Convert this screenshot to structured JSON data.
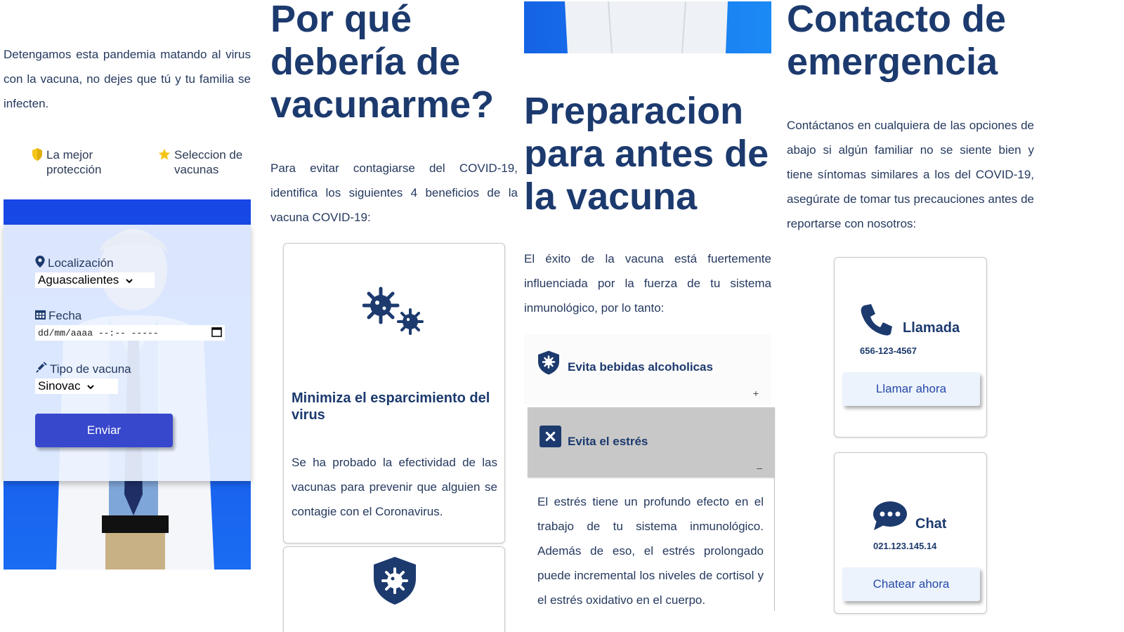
{
  "intro": {
    "text": "Detengamos esta pandemia matando al virus con la vacuna, no dejes que tú y tu familia se infecten."
  },
  "badges": [
    {
      "icon": "shield-icon",
      "label": "La mejor protección",
      "color": "#f5c518"
    },
    {
      "icon": "star-icon",
      "label": "Seleccion de vacunas",
      "color": "#f5c518"
    }
  ],
  "form": {
    "location": {
      "icon": "map-pin-icon",
      "label": "Localización",
      "value": "Aguascalientes"
    },
    "date": {
      "icon": "calendar-icon",
      "label": "Fecha",
      "value": "dd/mm/aaaa  --:--  -----"
    },
    "vaccine": {
      "icon": "syringe-icon",
      "label": "Tipo de vacuna",
      "value": "Sinovac"
    },
    "submit_label": "Enviar"
  },
  "why": {
    "title": "Por qué debería de vacunarme?",
    "text": "Para evitar contagiarse del COVID-19, identifica los siguientes 4 beneficios de la vacuna COVID-19:",
    "cards": [
      {
        "icon": "virus-icon",
        "title": "Minimiza el esparcimiento del virus",
        "text": "Se ha probado la efectividad de las vacunas para prevenir que alguien se contagie con el Coronavirus."
      },
      {
        "icon": "shield-virus-icon"
      }
    ]
  },
  "prep": {
    "title": "Preparacion para antes de la vacuna",
    "text": "El éxito de la vacuna está fuertemente influenciada por la fuerza de tu sistema inmunológico, por lo tanto:",
    "items": [
      {
        "icon": "shield-virus-icon",
        "title": "Evita bebidas alcoholicas",
        "toggle": "+"
      },
      {
        "icon": "close-box-icon",
        "title": "Evita el estrés",
        "toggle": "–",
        "body": "El estrés tiene un profundo efecto en el trabajo de tu sistema inmunológico. Además de eso, el estrés prolongado puede incremental los niveles de cortisol y el estrés oxidativo en el cuerpo."
      }
    ]
  },
  "contact": {
    "title": "Contacto de emergencia",
    "text": "Contáctanos en cualquiera de las opciones de abajo si algún familiar no se siente bien y tiene síntomas similares a los del COVID-19, asegúrate de tomar tus precauciones antes de reportarse con nosotros:",
    "cards": [
      {
        "icon": "phone-icon",
        "title": "Llamada",
        "number": "656-123-4567",
        "button": "Llamar ahora"
      },
      {
        "icon": "chat-icon",
        "title": "Chat",
        "number": "021.123.145.14",
        "button": "Chatear ahora"
      }
    ]
  },
  "colors": {
    "navy": "#1c3a6e",
    "blue": "#1747e6",
    "button": "#3848cc"
  }
}
